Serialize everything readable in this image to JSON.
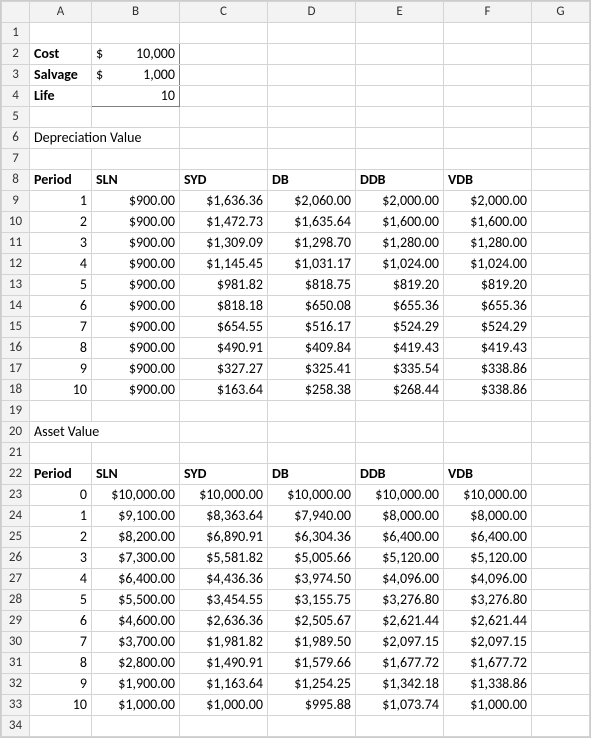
{
  "columns": [
    "A",
    "B",
    "C",
    "D",
    "E",
    "F",
    "G"
  ],
  "inputs": {
    "cost_label": "Cost",
    "cost_symbol": "$",
    "cost_value": "10,000",
    "salvage_label": "Salvage",
    "salvage_symbol": "$",
    "salvage_value": "1,000",
    "life_label": "Life",
    "life_value": "10"
  },
  "section1_title": "Depreciation Value",
  "section2_title": "Asset Value",
  "headers": {
    "period": "Period",
    "sln": "SLN",
    "syd": "SYD",
    "db": "DB",
    "ddb": "DDB",
    "vdb": "VDB"
  },
  "depr": [
    {
      "period": "1",
      "sln": "$900.00",
      "syd": "$1,636.36",
      "db": "$2,060.00",
      "ddb": "$2,000.00",
      "vdb": "$2,000.00"
    },
    {
      "period": "2",
      "sln": "$900.00",
      "syd": "$1,472.73",
      "db": "$1,635.64",
      "ddb": "$1,600.00",
      "vdb": "$1,600.00"
    },
    {
      "period": "3",
      "sln": "$900.00",
      "syd": "$1,309.09",
      "db": "$1,298.70",
      "ddb": "$1,280.00",
      "vdb": "$1,280.00"
    },
    {
      "period": "4",
      "sln": "$900.00",
      "syd": "$1,145.45",
      "db": "$1,031.17",
      "ddb": "$1,024.00",
      "vdb": "$1,024.00"
    },
    {
      "period": "5",
      "sln": "$900.00",
      "syd": "$981.82",
      "db": "$818.75",
      "ddb": "$819.20",
      "vdb": "$819.20"
    },
    {
      "period": "6",
      "sln": "$900.00",
      "syd": "$818.18",
      "db": "$650.08",
      "ddb": "$655.36",
      "vdb": "$655.36"
    },
    {
      "period": "7",
      "sln": "$900.00",
      "syd": "$654.55",
      "db": "$516.17",
      "ddb": "$524.29",
      "vdb": "$524.29"
    },
    {
      "period": "8",
      "sln": "$900.00",
      "syd": "$490.91",
      "db": "$409.84",
      "ddb": "$419.43",
      "vdb": "$419.43"
    },
    {
      "period": "9",
      "sln": "$900.00",
      "syd": "$327.27",
      "db": "$325.41",
      "ddb": "$335.54",
      "vdb": "$338.86"
    },
    {
      "period": "10",
      "sln": "$900.00",
      "syd": "$163.64",
      "db": "$258.38",
      "ddb": "$268.44",
      "vdb": "$338.86"
    }
  ],
  "asset": [
    {
      "period": "0",
      "sln": "$10,000.00",
      "syd": "$10,000.00",
      "db": "$10,000.00",
      "ddb": "$10,000.00",
      "vdb": "$10,000.00"
    },
    {
      "period": "1",
      "sln": "$9,100.00",
      "syd": "$8,363.64",
      "db": "$7,940.00",
      "ddb": "$8,000.00",
      "vdb": "$8,000.00"
    },
    {
      "period": "2",
      "sln": "$8,200.00",
      "syd": "$6,890.91",
      "db": "$6,304.36",
      "ddb": "$6,400.00",
      "vdb": "$6,400.00"
    },
    {
      "period": "3",
      "sln": "$7,300.00",
      "syd": "$5,581.82",
      "db": "$5,005.66",
      "ddb": "$5,120.00",
      "vdb": "$5,120.00"
    },
    {
      "period": "4",
      "sln": "$6,400.00",
      "syd": "$4,436.36",
      "db": "$3,974.50",
      "ddb": "$4,096.00",
      "vdb": "$4,096.00"
    },
    {
      "period": "5",
      "sln": "$5,500.00",
      "syd": "$3,454.55",
      "db": "$3,155.75",
      "ddb": "$3,276.80",
      "vdb": "$3,276.80"
    },
    {
      "period": "6",
      "sln": "$4,600.00",
      "syd": "$2,636.36",
      "db": "$2,505.67",
      "ddb": "$2,621.44",
      "vdb": "$2,621.44"
    },
    {
      "period": "7",
      "sln": "$3,700.00",
      "syd": "$1,981.82",
      "db": "$1,989.50",
      "ddb": "$2,097.15",
      "vdb": "$2,097.15"
    },
    {
      "period": "8",
      "sln": "$2,800.00",
      "syd": "$1,490.91",
      "db": "$1,579.66",
      "ddb": "$1,677.72",
      "vdb": "$1,677.72"
    },
    {
      "period": "9",
      "sln": "$1,900.00",
      "syd": "$1,163.64",
      "db": "$1,254.25",
      "ddb": "$1,342.18",
      "vdb": "$1,338.86"
    },
    {
      "period": "10",
      "sln": "$1,000.00",
      "syd": "$1,000.00",
      "db": "$995.88",
      "ddb": "$1,073.74",
      "vdb": "$1,000.00"
    }
  ]
}
